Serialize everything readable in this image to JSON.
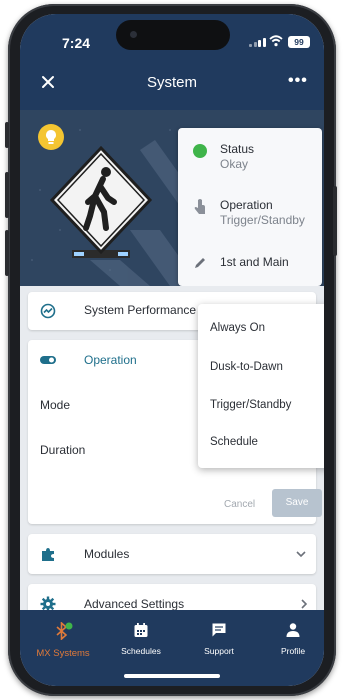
{
  "status_bar": {
    "time": "7:24",
    "battery": "99"
  },
  "header": {
    "title": "System",
    "more": "•••"
  },
  "status_card": {
    "status_label": "Status",
    "status_value": "Okay",
    "operation_label": "Operation",
    "operation_value": "Trigger/Standby",
    "location": "1st and Main"
  },
  "sections": {
    "performance": "System Performance",
    "operation": "Operation",
    "mode_label": "Mode",
    "duration_label": "Duration",
    "cancel": "Cancel",
    "save": "Save",
    "modules": "Modules",
    "advanced": "Advanced Settings"
  },
  "mode_dropdown": {
    "options": [
      "Always On",
      "Dusk-to-Dawn",
      "Trigger/Standby",
      "Schedule"
    ]
  },
  "bottom_nav": {
    "items": [
      {
        "label": "MX Systems",
        "icon": "bluetooth-icon"
      },
      {
        "label": "Schedules",
        "icon": "calendar-icon"
      },
      {
        "label": "Support",
        "icon": "chat-icon"
      },
      {
        "label": "Profile",
        "icon": "person-icon"
      }
    ]
  },
  "colors": {
    "header_bg": "#203a5e",
    "accent": "#e07a3a",
    "status_ok": "#3fb44a",
    "icon_teal": "#1f6f8b",
    "bulb": "#f4c531"
  }
}
